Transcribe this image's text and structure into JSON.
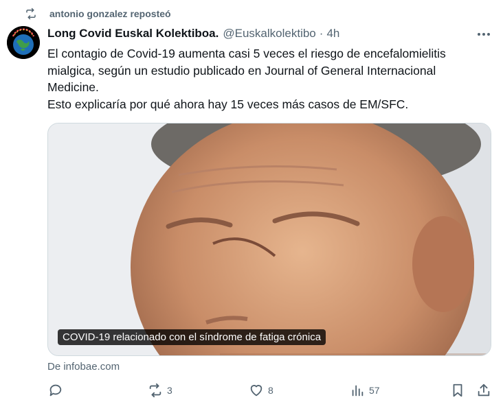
{
  "repost": {
    "text": "antonio gonzalez reposteó",
    "icon": "repost-icon"
  },
  "tweet": {
    "author_name": "Long Covid Euskal Kolektiboa.",
    "author_handle": "@Euskalkolektibo",
    "separator": "·",
    "time": "4h",
    "avatar_text": "LONG COVID",
    "text_lines": [
      "El contagio de Covid-19 aumenta casi 5 veces el riesgo de encefalomielitis mialgica, según un estudio publicado en Journal of General Internacional Medicine.",
      "Esto explicaría por qué ahora hay 15 veces más casos de EM/SFC."
    ]
  },
  "card": {
    "caption": "COVID-19 relacionado con el síndrome de fatiga crónica",
    "source": "De infobae.com"
  },
  "actions": {
    "reply_count": "",
    "repost_count": "3",
    "like_count": "8",
    "views_count": "57"
  },
  "colors": {
    "text": "#0f1419",
    "muted": "#536471",
    "border": "#cfd9de"
  }
}
